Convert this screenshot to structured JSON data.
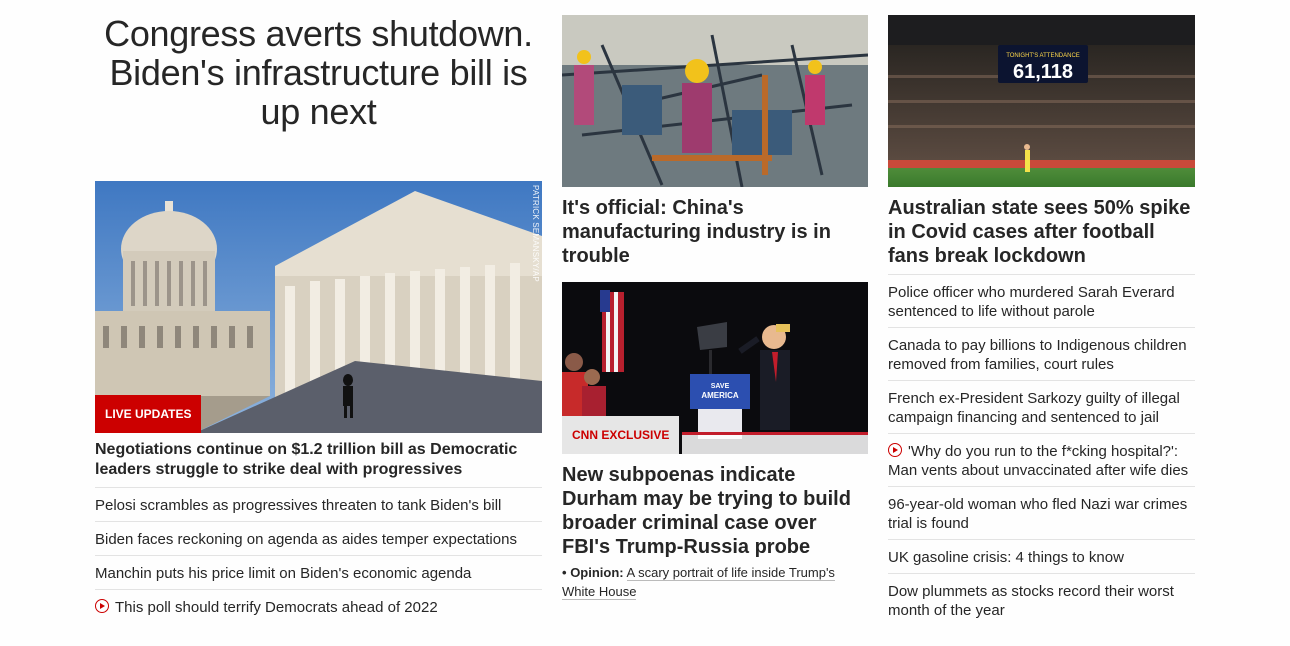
{
  "left": {
    "headline": "Congress averts shutdown. Biden's infrastructure bill is up next",
    "photo_credit": "PATRICK SEMANSKY/AP",
    "badge": "LIVE UPDATES",
    "lead": "Negotiations continue on $1.2 trillion bill as Democratic leaders struggle to strike deal with progressives",
    "items": [
      {
        "text": "Pelosi scrambles as progressives threaten to tank Biden's bill",
        "video": false
      },
      {
        "text": "Biden faces reckoning on agenda as aides temper expectations",
        "video": false
      },
      {
        "text": "Manchin puts his price limit on Biden's economic agenda",
        "video": false
      },
      {
        "text": "This poll should terrify Democrats ahead of 2022",
        "video": true
      }
    ]
  },
  "middle": {
    "story1_title": "It's official: China's manufacturing industry is in trouble",
    "badge": "CNN EXCLUSIVE",
    "story2_title": "New subpoenas indicate Durham may be trying to build broader criminal case over FBI's Trump-Russia probe",
    "opinion_bullet": "•",
    "opinion_label": "Opinion:",
    "opinion_text": "A scary portrait of life inside Trump's White House",
    "podium_sign_1": "SAVE",
    "podium_sign_2": "AMERICA"
  },
  "right": {
    "stadium_sign_label": "TONIGHT'S ATTENDANCE",
    "stadium_sign_value": "61,118",
    "story_title": "Australian state sees 50% spike in Covid cases after football fans break lockdown",
    "items": [
      {
        "text": "Police officer who murdered Sarah Everard sentenced to life without parole",
        "video": false
      },
      {
        "text": "Canada to pay billions to Indigenous children removed from families, court rules",
        "video": false
      },
      {
        "text": "French ex-President Sarkozy guilty of illegal campaign financing and sentenced to jail",
        "video": false
      },
      {
        "text": "'Why do you run to the f*cking hospital?': Man vents about unvaccinated after wife dies",
        "video": true
      },
      {
        "text": "96-year-old woman who fled Nazi war crimes trial is found",
        "video": false
      },
      {
        "text": "UK gasoline crisis: 4 things to know",
        "video": false
      },
      {
        "text": "Dow plummets as stocks record their worst month of the year",
        "video": false
      }
    ]
  },
  "colors": {
    "brand_red": "#cc0000",
    "text": "#262626",
    "divider": "#e3e3e3"
  }
}
